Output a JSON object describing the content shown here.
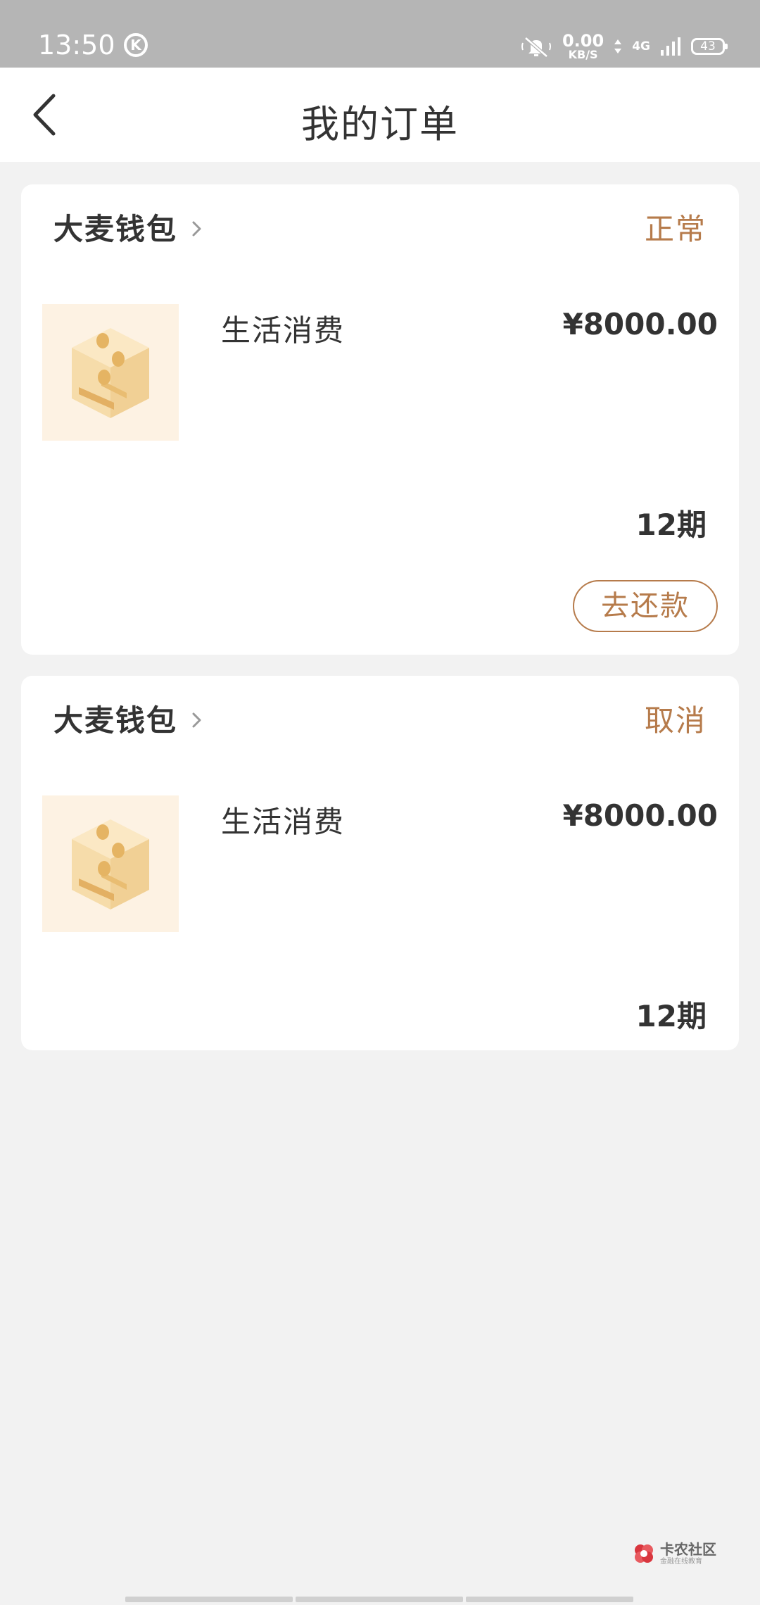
{
  "status_bar": {
    "time": "13:50",
    "k_icon_letter": "K",
    "net_speed_value": "0.00",
    "net_speed_unit": "KB/S",
    "network_type": "4G",
    "battery_level": "43"
  },
  "nav": {
    "title": "我的订单"
  },
  "orders": [
    {
      "merchant": "大麦钱包",
      "status": "正常",
      "product": "生活消费",
      "amount": "¥8000.00",
      "term": "12期",
      "action_label": "去还款"
    },
    {
      "merchant": "大麦钱包",
      "status": "取消",
      "product": "生活消费",
      "amount": "¥8000.00",
      "term": "12期"
    }
  ],
  "watermark": {
    "title": "卡农社区",
    "subtitle": "金融在线教育"
  },
  "colors": {
    "accent": "#b67b4b",
    "text": "#333333",
    "background": "#f2f2f2",
    "status_bar": "#b5b5b5"
  }
}
